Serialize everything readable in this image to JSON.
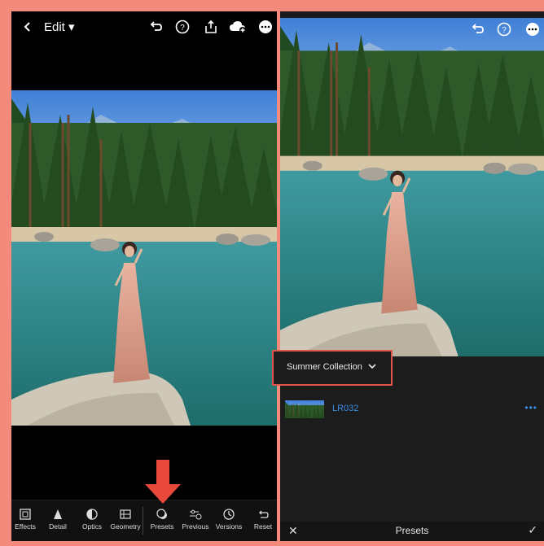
{
  "left": {
    "header": {
      "edit_label": "Edit ▾"
    },
    "toolbar": {
      "items": [
        {
          "label": "Effects",
          "icon": "effects-icon"
        },
        {
          "label": "Detail",
          "icon": "detail-icon"
        },
        {
          "label": "Optics",
          "icon": "optics-icon"
        },
        {
          "label": "Geometry",
          "icon": "geometry-icon"
        },
        {
          "label": "Presets",
          "icon": "presets-icon"
        },
        {
          "label": "Previous",
          "icon": "previous-icon"
        },
        {
          "label": "Versions",
          "icon": "versions-icon"
        },
        {
          "label": "Reset",
          "icon": "reset-icon"
        }
      ]
    }
  },
  "right": {
    "collection": {
      "label": "Summer Collection"
    },
    "preset": {
      "name": "LR032",
      "more": "•••"
    },
    "bottom_bar": {
      "cancel": "✕",
      "title": "Presets",
      "confirm": "✓"
    }
  },
  "colors": {
    "frame": "#f48a7c",
    "highlight": "#e0564a",
    "accent": "#3a8ee6"
  }
}
